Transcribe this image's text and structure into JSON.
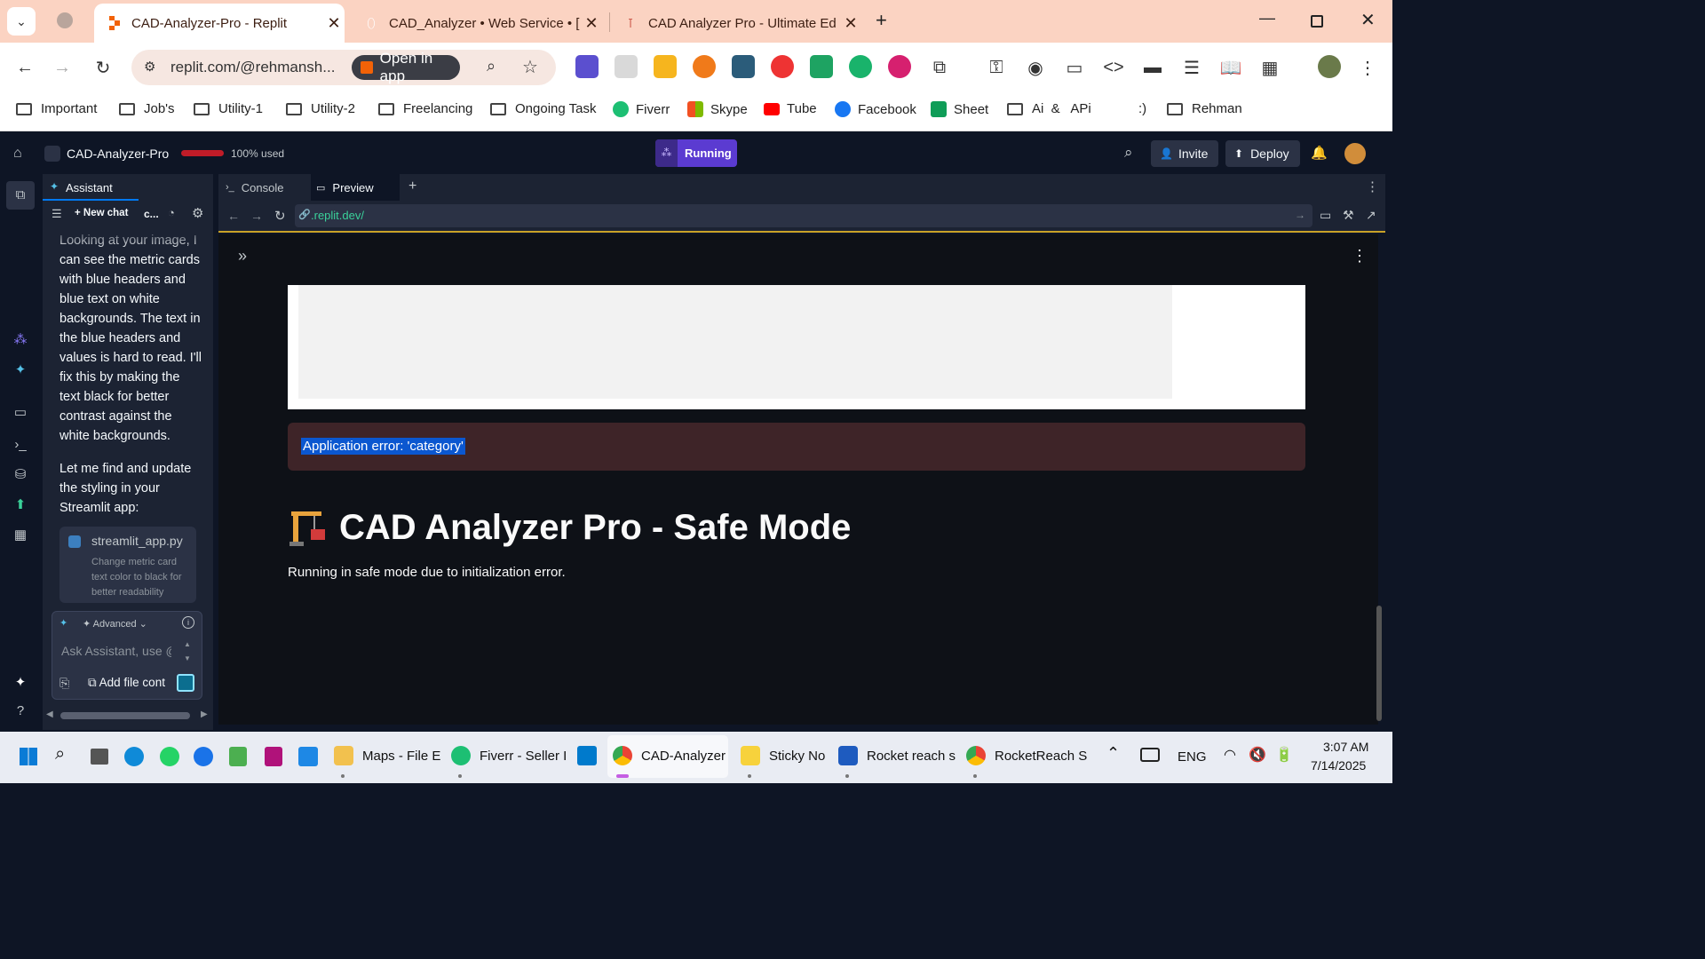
{
  "browser": {
    "tabs": [
      {
        "title": "CAD-Analyzer-Pro - Replit",
        "active": true
      },
      {
        "title": "CAD_Analyzer • Web Service • [",
        "active": false
      },
      {
        "title": "CAD Analyzer Pro - Ultimate Ed",
        "active": false
      }
    ],
    "url": "replit.com/@rehmansh...",
    "open_in_app": "Open in app",
    "bookmarks": [
      "Important",
      "Job's",
      "Utility-1",
      "Utility-2",
      "Freelancing",
      "Ongoing Task",
      "Fiverr",
      "Skype",
      "Tube",
      "Facebook",
      "Sheet",
      "Ai  &   APi",
      ":)",
      "Rehman"
    ]
  },
  "replit": {
    "project_name": "CAD-Analyzer-Pro",
    "usage": "100% used",
    "run_status": "Running",
    "invite": "Invite",
    "deploy": "Deploy",
    "assistant_tab": "Assistant",
    "new_chat": "New chat",
    "chat_abbrev": "c...",
    "chat_message_1": "Looking at your image, I can see the metric cards with blue headers and blue text on white backgrounds. The text in the blue headers and values is hard to read. I'll fix this by making the text black for better contrast against the white backgrounds.",
    "chat_message_2": "Let me find and update the styling in your Streamlit app:",
    "file_card": {
      "filename": "streamlit_app.py",
      "description": "Change metric card text color to black for better readability"
    },
    "advanced": "Advanced",
    "input_placeholder": "Ask Assistant, use @",
    "add_file": "Add file cont",
    "pane_tabs": [
      "Console",
      "Preview"
    ],
    "preview_url": ".replit.dev/"
  },
  "app": {
    "error": "Application error: 'category'",
    "title": "CAD Analyzer Pro - Safe Mode",
    "subtitle": "Running in safe mode due to initialization error."
  },
  "taskbar": {
    "items": [
      "Maps - File E",
      "Fiverr - Seller I",
      "CAD-Analyzer",
      "Sticky No",
      "Rocket reach s",
      "RocketReach S"
    ],
    "lang": "ENG",
    "time": "3:07 AM",
    "date": "7/14/2025"
  },
  "colors": {
    "accent": "#0079f2",
    "running": "#5b3bd1",
    "error_bg": "#3e2428",
    "usage_bar": "#c01c28"
  }
}
